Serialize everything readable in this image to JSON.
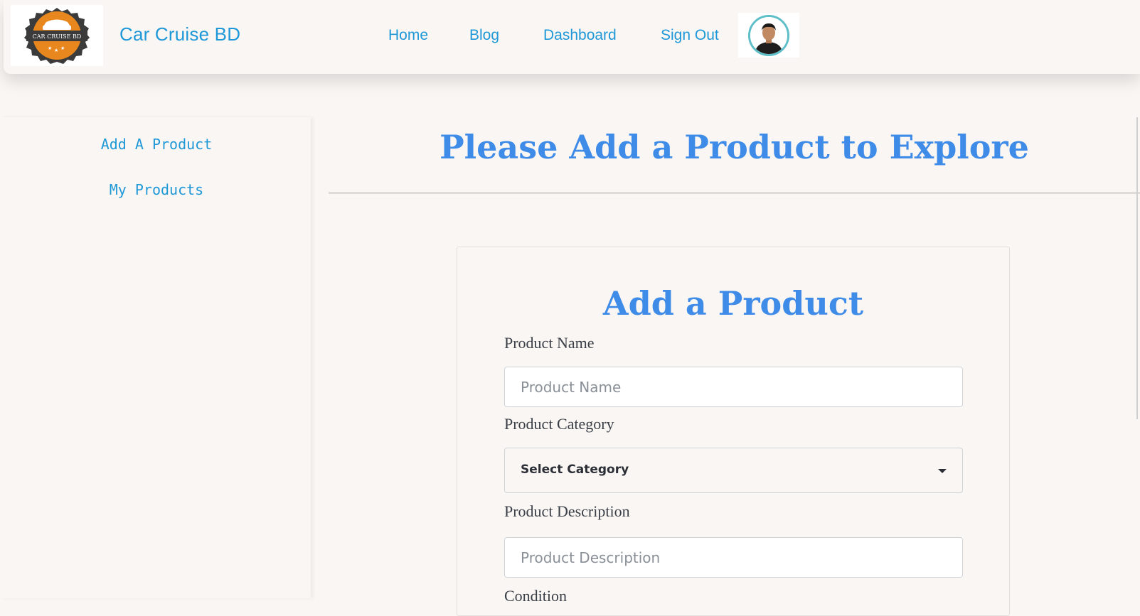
{
  "navbar": {
    "logo_text": "CAR CRUISE BD",
    "brand": "Car Cruise BD",
    "links": [
      "Home",
      "Blog",
      "Dashboard",
      "Sign Out"
    ]
  },
  "sidebar": {
    "items": [
      "Add A Product",
      "My Products"
    ]
  },
  "main": {
    "page_title": "Please Add a Product to Explore",
    "form": {
      "heading": "Add a Product",
      "product_name_label": "Product Name",
      "product_name_placeholder": "Product Name",
      "category_label": "Product Category",
      "category_selected": "Select Category",
      "description_label": "Product Description",
      "description_placeholder": "Product Description",
      "condition_label": "Condition"
    }
  },
  "colors": {
    "accent_link": "#1f98d8",
    "heading_blue": "#3f8be8",
    "background": "#f9f6f3",
    "logo_orange": "#e8871e",
    "avatar_ring": "#5fbfc9"
  }
}
